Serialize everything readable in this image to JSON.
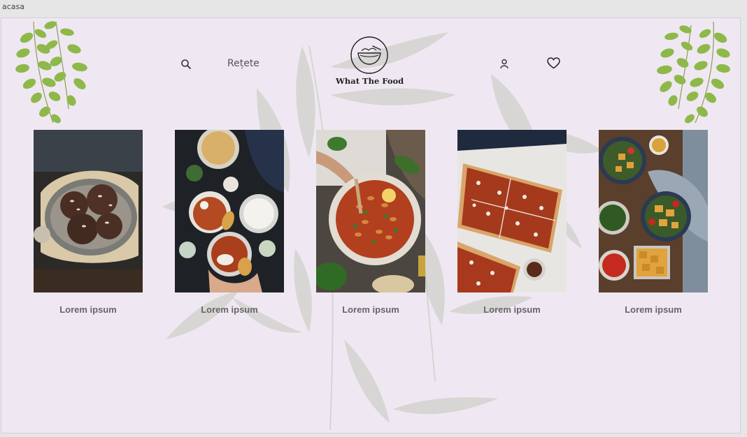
{
  "window": {
    "tab_title": "acasa"
  },
  "header": {
    "recipes_link": "Rețete",
    "logo_text": "What The Food",
    "icons": [
      "search-icon",
      "user-icon",
      "heart-icon",
      "bowl-logo-icon"
    ]
  },
  "cards": [
    {
      "caption": "Lorem ipsum",
      "image": "chocolate-cookies"
    },
    {
      "caption": "Lorem ipsum",
      "image": "curry-rice-naan-spread"
    },
    {
      "caption": "Lorem ipsum",
      "image": "pasta-skillet"
    },
    {
      "caption": "Lorem ipsum",
      "image": "tomato-flatbread-pizza"
    },
    {
      "caption": "Lorem ipsum",
      "image": "tofu-bowls-spread"
    }
  ],
  "colors": {
    "background": "#efe8f2",
    "leaf_green": "#8fb84a",
    "caption_grey": "#666666"
  }
}
